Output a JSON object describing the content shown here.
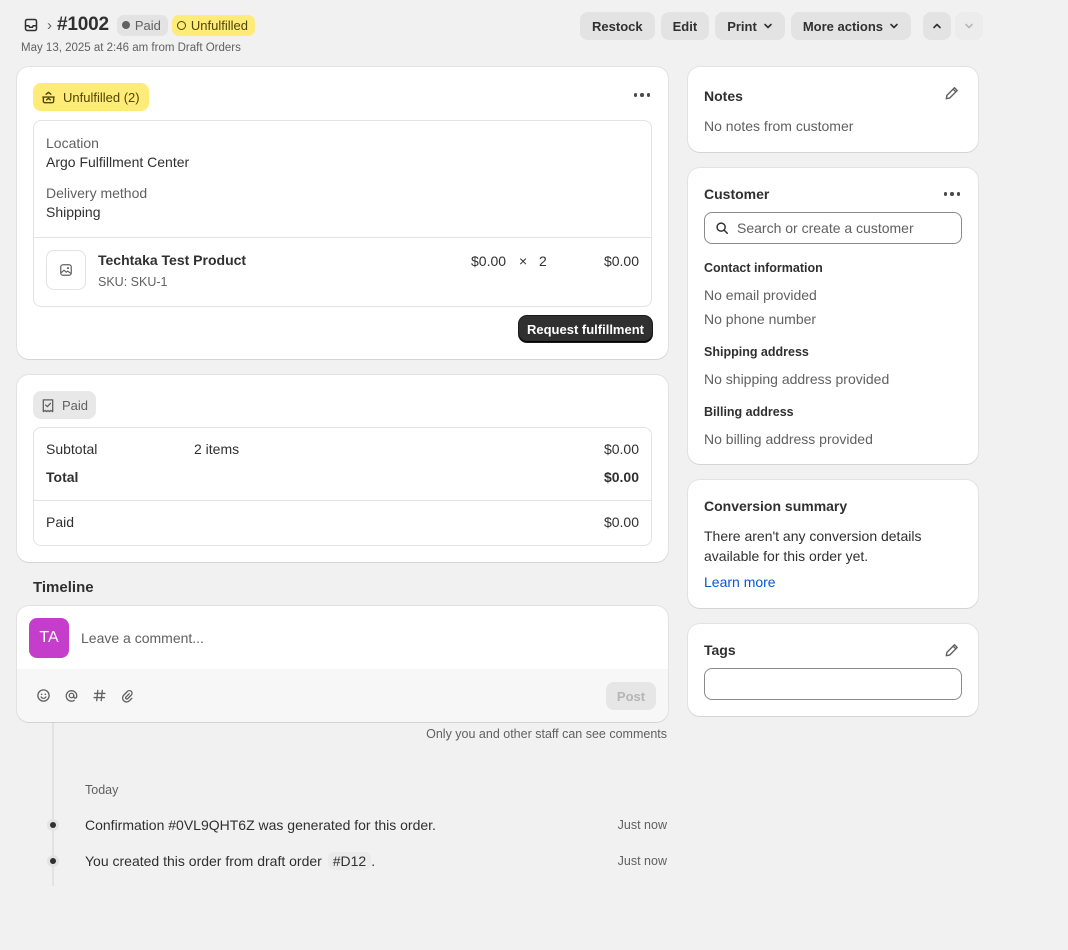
{
  "header": {
    "order_number": "#1002",
    "breadcrumb_separator": "›",
    "paid_badge": "Paid",
    "unfulfilled_badge": "Unfulfilled",
    "subline": "May 13, 2025 at 2:46 am from Draft Orders",
    "actions": {
      "restock": "Restock",
      "edit": "Edit",
      "print": "Print",
      "more": "More actions"
    }
  },
  "fulfillment": {
    "badge": "Unfulfilled (2)",
    "location_label": "Location",
    "location_value": "Argo Fulfillment Center",
    "delivery_label": "Delivery method",
    "delivery_value": "Shipping",
    "item": {
      "name": "Techtaka Test Product",
      "sku": "SKU: SKU-1",
      "price": "$0.00",
      "times": "×",
      "qty": "2",
      "total": "$0.00"
    },
    "request_button": "Request fulfillment"
  },
  "payment": {
    "badge": "Paid",
    "subtotal_label": "Subtotal",
    "subtotal_items": "2 items",
    "subtotal_value": "$0.00",
    "total_label": "Total",
    "total_value": "$0.00",
    "paid_label": "Paid",
    "paid_value": "$0.00"
  },
  "timeline": {
    "heading": "Timeline",
    "avatar_initials": "TA",
    "comment_placeholder": "Leave a comment...",
    "post_button": "Post",
    "visibility_note": "Only you and other staff can see comments",
    "date_group": "Today",
    "events": [
      {
        "text": "Confirmation #0VL9QHT6Z was generated for this order.",
        "time": "Just now"
      },
      {
        "text_before": "You created this order from draft order",
        "chip": "#D12",
        "text_after": ".",
        "time": "Just now"
      }
    ]
  },
  "notes": {
    "title": "Notes",
    "text": "No notes from customer"
  },
  "customer": {
    "title": "Customer",
    "search_placeholder": "Search or create a customer",
    "contact_heading": "Contact information",
    "email": "No email provided",
    "phone": "No phone number",
    "shipping_heading": "Shipping address",
    "shipping": "No shipping address provided",
    "billing_heading": "Billing address",
    "billing": "No billing address provided"
  },
  "conversion": {
    "title": "Conversion summary",
    "text_line1": "There aren't any conversion details",
    "text_line2": "available for this order yet.",
    "link": "Learn more"
  },
  "tags": {
    "title": "Tags",
    "value": ""
  },
  "colors": {
    "unfulfilled": "#ffeb78",
    "avatar": "#c43ecb",
    "link": "#005bd3",
    "primary_button": "#303030"
  }
}
